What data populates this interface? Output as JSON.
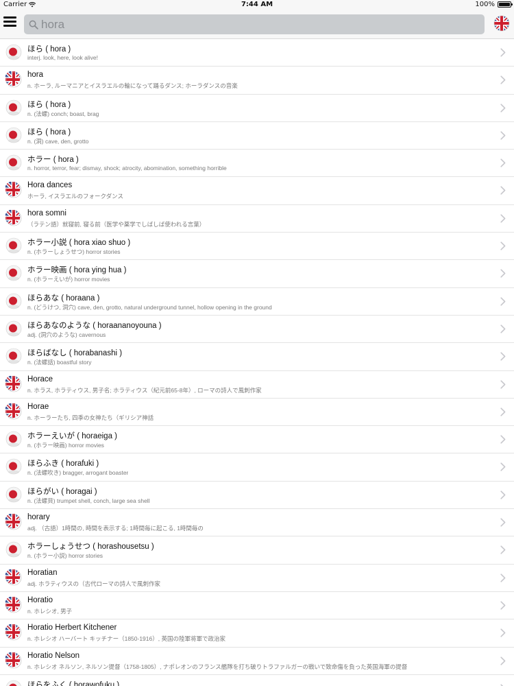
{
  "status_bar": {
    "carrier": "Carrier",
    "time": "7:44 AM",
    "battery": "100%",
    "battery_level": 1.0,
    "wifi_icon": "wifi-icon",
    "battery_icon": "battery-icon"
  },
  "nav": {
    "menu_icon": "hamburger-menu-icon",
    "search_icon": "search-icon",
    "language_flag_icon": "uk-flag-icon"
  },
  "search": {
    "value": "hora"
  },
  "colors": {
    "flag_red": "#cc1f2f",
    "flag_blue": "#1f3d8f",
    "chevron": "#c7c7cc",
    "row_separator": "#e3e3e3",
    "search_field": "#c9cccf"
  },
  "results": [
    {
      "flag": "jp",
      "title": "ほら ( hora )",
      "subtitle": "interj. look, here, look alive!"
    },
    {
      "flag": "uk",
      "title": "hora",
      "subtitle": "n. ホーラ, ルーマニアとイスラエルの輪になって踊るダンス; ホーラダンスの音楽"
    },
    {
      "flag": "jp",
      "title": "ほら ( hora )",
      "subtitle": "n. (法螺) conch; boast, brag"
    },
    {
      "flag": "jp",
      "title": "ほら ( hora )",
      "subtitle": "n. (洞) cave, den, grotto"
    },
    {
      "flag": "jp",
      "title": "ホラー ( hora )",
      "subtitle": "n. horror, terror, fear; dismay, shock; atrocity, abomination, something horrible"
    },
    {
      "flag": "uk",
      "title": "Hora dances",
      "subtitle": "ホーラ, イスラエルのフォークダンス"
    },
    {
      "flag": "uk",
      "title": "hora somni",
      "subtitle": "（ラテン語）就寝前, 寝る前（医学や薬学でしばしば使われる言葉）"
    },
    {
      "flag": "jp",
      "title": "ホラー小説 ( hora xiao shuo )",
      "subtitle": "n. (ホラーしょうせつ) horror stories"
    },
    {
      "flag": "jp",
      "title": "ホラー映画 ( hora ying hua )",
      "subtitle": "n. (ホラーえいが) horror movies"
    },
    {
      "flag": "jp",
      "title": "ほらあな ( horaana )",
      "subtitle": "n. (どうけつ, 洞穴) cave, den, grotto, natural underground tunnel, hollow opening in the ground"
    },
    {
      "flag": "jp",
      "title": "ほらあなのような ( horaananoyouna )",
      "subtitle": "adj. (洞穴のような) cavernous"
    },
    {
      "flag": "jp",
      "title": "ほらばなし ( horabanashi )",
      "subtitle": "n. (法螺話) boastful story"
    },
    {
      "flag": "uk",
      "title": "Horace",
      "subtitle": "n. ホラス, ホラティウス, 男子名; ホラティウス（紀元前65-8年）, ローマの詩人で風刺作家"
    },
    {
      "flag": "uk",
      "title": "Horae",
      "subtitle": "n. ホーラーたち, 四季の女神たち（ギリシア神話"
    },
    {
      "flag": "jp",
      "title": "ホラーえいが ( horaeiga )",
      "subtitle": "n. (ホラー映画) horror movies"
    },
    {
      "flag": "jp",
      "title": "ほらふき ( horafuki )",
      "subtitle": "n. (法螺吹き) bragger, arrogant boaster"
    },
    {
      "flag": "jp",
      "title": "ほらがい ( horagai )",
      "subtitle": "n. (法螺貝) trumpet shell, conch, large sea shell"
    },
    {
      "flag": "uk",
      "title": "horary",
      "subtitle": "adj. （古語）1時間の, 時間を表示する; 1時間毎に起こる, 1時間毎の"
    },
    {
      "flag": "jp",
      "title": "ホラーしょうせつ ( horashousetsu )",
      "subtitle": "n. (ホラー小説) horror stories"
    },
    {
      "flag": "uk",
      "title": "Horatian",
      "subtitle": "adj. ホラティウスの（古代ローマの詩人で風刺作家"
    },
    {
      "flag": "uk",
      "title": "Horatio",
      "subtitle": "n. ホレシオ, 男子"
    },
    {
      "flag": "uk",
      "title": "Horatio Herbert Kitchener",
      "subtitle": "n. ホレシオ ハーバート キッチナー（1850-1916）, 英国の陸軍将軍で政治家"
    },
    {
      "flag": "uk",
      "title": "Horatio Nelson",
      "subtitle": "n. ホレシオ ネルソン, ネルソン提督（1758-1805）, ナポレオンのフランス艦隊を打ち破りトラファルガーの戦いで致命傷を負った英国海軍の提督"
    },
    {
      "flag": "jp",
      "title": "ほらをふく ( horawofuku )",
      "subtitle": ""
    }
  ]
}
